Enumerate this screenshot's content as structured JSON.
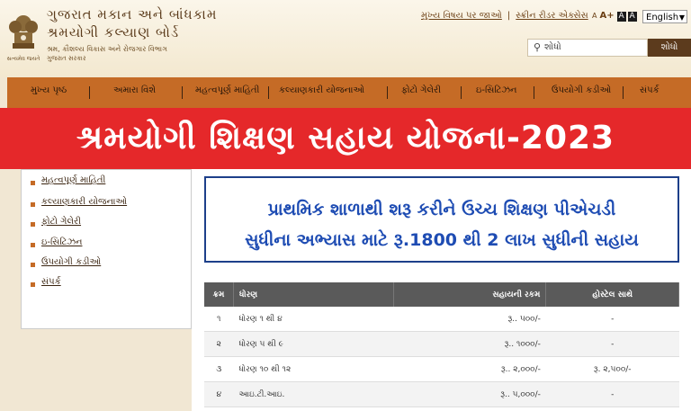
{
  "header": {
    "org_line1": "ગુજરાત મકાન અને બાંધકામ",
    "org_line2": "શ્રમયોગી કલ્યાણ બોર્ડ",
    "org_line3": "શ્રમ, કૌશલ્ય વિકાસ અને રોજગાર વિભાગ",
    "org_line4": "ગુજરાત સરકાર",
    "emblem_caption": "સત્યમેવ જયતે",
    "top_links": [
      "મુખ્ય વિષય પર જાઓ",
      "સ્ક્રીન રીડર એક્સેસ"
    ],
    "font_controls": [
      "A",
      "A+",
      "A",
      "A"
    ],
    "language": "English",
    "search_placeholder": "શોધો",
    "search_button": "શોધો"
  },
  "nav": {
    "items": [
      "મુખ્ય પૃષ્ઠ",
      "અમારા વિશે",
      "મહત્વપૂર્ણ માહિતી",
      "કલ્યાણકારી યોજનાઓ",
      "ફોટો ગેલેરી",
      "ઇ-સિટિઝન",
      "ઉપયોગી કડીઓ",
      "સંપર્ક"
    ]
  },
  "banner": {
    "title": "શ્રમયોગી શિક્ષણ સહાય યોજના-2023"
  },
  "sidebar": {
    "items": [
      "મહત્વપૂર્ણ માહિતી",
      "કલ્યાણકારી યોજનાઓ",
      "ફોટો ગેલેરી",
      "ઇ-સિટિઝન",
      "ઉપયોગી કડીઓ",
      "સંપર્ક"
    ]
  },
  "info": {
    "line1": "પ્રાથમિક શાળાથી શરૂ કરીને ઉચ્ચ શિક્ષણ પીએચડી",
    "line2": "સુધીના અભ્યાસ માટે રૂ.1800 થી 2 લાખ સુધીની સહાય"
  },
  "table": {
    "headers": [
      "ક્રમ",
      "ધોરણ",
      "સહાયની રકમ",
      "હોસ્ટેલ સાથે"
    ],
    "rows": [
      [
        "૧",
        "ધોરણ ૧ થી ૪",
        "રૂ.. ૫૦૦/-",
        "-"
      ],
      [
        "૨",
        "ધોરણ ૫ થી ૯",
        "રૂ.. ૧૦૦૦/-",
        "-"
      ],
      [
        "૩",
        "ધોરણ ૧૦ થી ૧૨",
        "રૂ.. ૨,૦૦૦/-",
        "રૂ. ૨,૫૦૦/-"
      ],
      [
        "૪",
        "આઇ.ટી.આઇ.",
        "રૂ.. ૫,૦૦૦/-",
        "-"
      ]
    ]
  },
  "colors": {
    "nav": "#c56b26",
    "banner": "#e5282a",
    "info_text": "#1e4cb3",
    "table_header": "#5a5a5a"
  }
}
